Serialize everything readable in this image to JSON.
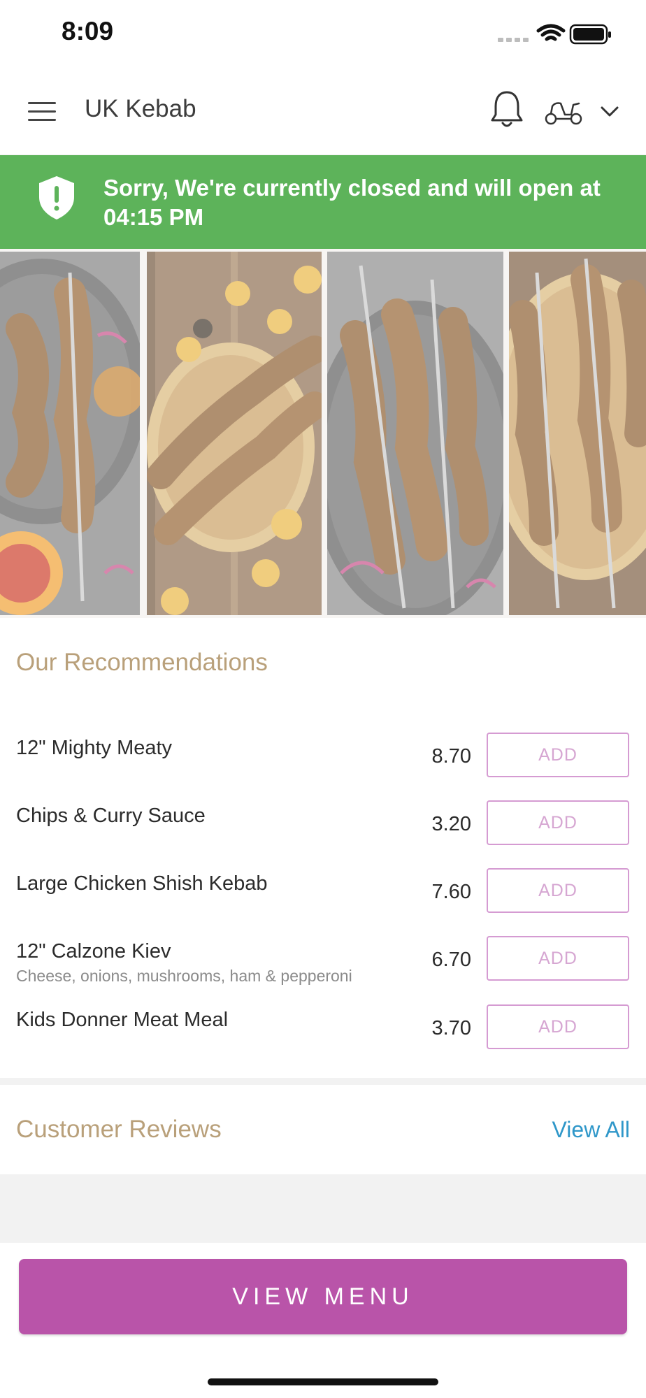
{
  "status_bar": {
    "time": "8:09",
    "icons": [
      "cellular-signal-icon",
      "wifi-icon",
      "battery-icon"
    ]
  },
  "header": {
    "title": "UK Kebab",
    "icons": [
      "hamburger-menu-icon",
      "bell-icon",
      "scooter-icon",
      "chevron-down-icon"
    ]
  },
  "banner": {
    "message": "Sorry, We're currently closed and will open at 04:15 PM",
    "icon": "shield-alert-icon",
    "color": "#5db35a"
  },
  "hero": {
    "description_icon": "kebab-skewer-photo-collage"
  },
  "recommendations": {
    "title": "Our Recommendations",
    "add_label": "ADD",
    "items": [
      {
        "name": "12\" Mighty Meaty",
        "description": "",
        "price": "8.70"
      },
      {
        "name": "Chips & Curry Sauce",
        "description": "",
        "price": "3.20"
      },
      {
        "name": "Large Chicken Shish Kebab",
        "description": "",
        "price": "7.60"
      },
      {
        "name": "12\" Calzone Kiev",
        "description": "Cheese, onions, mushrooms, ham & pepperoni",
        "price": "6.70"
      },
      {
        "name": "Kids Donner Meat Meal",
        "description": "",
        "price": "3.70"
      }
    ]
  },
  "reviews": {
    "title": "Customer Reviews",
    "view_all": "View All"
  },
  "footer": {
    "view_menu": "VIEW MENU",
    "accent_color": "#b954a9"
  }
}
